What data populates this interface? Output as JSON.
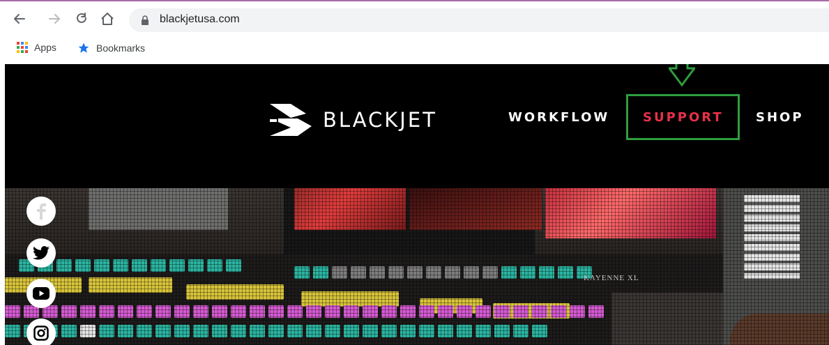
{
  "browser": {
    "url": "blackjetusa.com",
    "bookmarks": [
      {
        "label": "Apps",
        "icon": "apps-grid-icon"
      },
      {
        "label": "Bookmarks",
        "icon": "star-icon"
      }
    ]
  },
  "site": {
    "logo_text": "BLACKJET",
    "nav": [
      {
        "label": "WORKFLOW",
        "active": false
      },
      {
        "label": "SUPPORT",
        "active": true
      },
      {
        "label": "SHOP",
        "active": false
      }
    ],
    "hero": {
      "device_label": "KAYENNE XL"
    },
    "social": [
      "facebook-icon",
      "twitter-icon",
      "youtube-icon",
      "instagram-icon"
    ]
  },
  "colors": {
    "active_nav": "#e8314a",
    "highlight": "#2e9d3e",
    "header_bg": "#000000"
  }
}
